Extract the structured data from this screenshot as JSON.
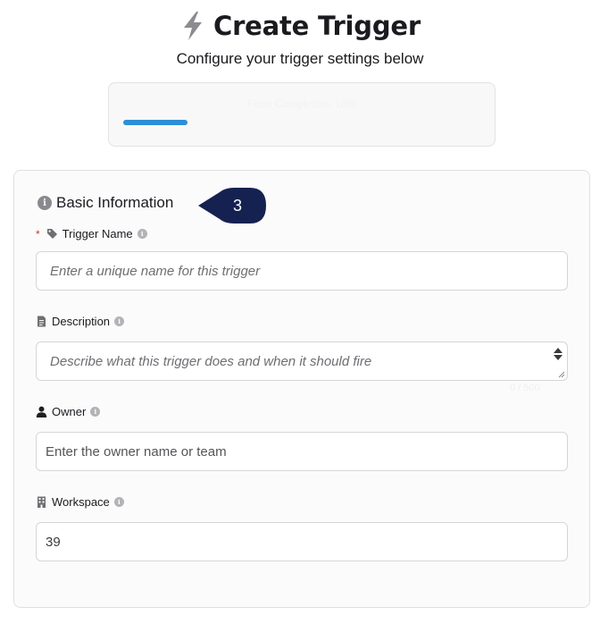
{
  "header": {
    "title": "Create Trigger",
    "title_icon": "lightning-bolt-icon",
    "subtitle": "Configure your trigger settings below"
  },
  "progress": {
    "label": "Form Completion: 18%",
    "fraction": 0.18,
    "color": "#2d8fd8"
  },
  "section": {
    "title": "Basic Information",
    "step_number": "3"
  },
  "fields": {
    "trigger_name": {
      "label": "Trigger Name",
      "required_mark": "*",
      "icon": "tag-icon",
      "placeholder": "Enter a unique name for this trigger"
    },
    "description": {
      "label": "Description",
      "icon": "document-icon",
      "placeholder": "Describe what this trigger does and when it should fire",
      "hint": "0 / 500"
    },
    "owner": {
      "label": "Owner",
      "icon": "person-icon",
      "placeholder": "Enter the owner name or team"
    },
    "workspace": {
      "label": "Workspace",
      "icon": "building-icon",
      "value": "39"
    }
  },
  "colors": {
    "accent": "#2d8fd8",
    "step_bubble": "#152150",
    "required": "#d2302f"
  }
}
